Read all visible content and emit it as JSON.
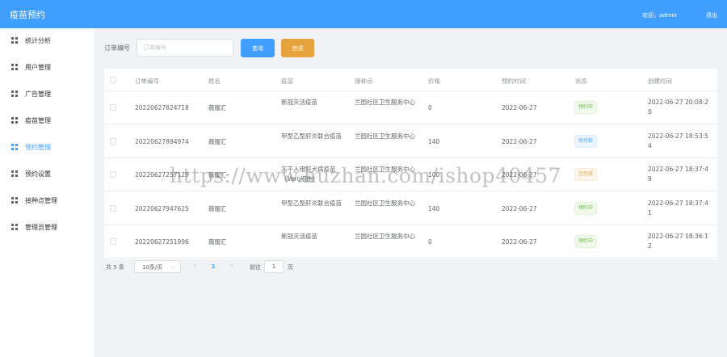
{
  "header": {
    "title": "疫苗预约",
    "welcome": "欢迎，admin",
    "logout": "退出"
  },
  "sidebar": {
    "items": [
      {
        "label": "统计分析"
      },
      {
        "label": "用户管理"
      },
      {
        "label": "广告管理"
      },
      {
        "label": "疫苗管理"
      },
      {
        "label": "预约管理"
      },
      {
        "label": "预约设置"
      },
      {
        "label": "接种点管理"
      },
      {
        "label": "管理员管理"
      }
    ],
    "active_index": 4
  },
  "search": {
    "label": "订单编号",
    "placeholder": "订单编号",
    "query_button": "查询",
    "done_button": "完成"
  },
  "table": {
    "columns": [
      "订单编号",
      "姓名",
      "疫苗",
      "接种点",
      "价格",
      "预约时间",
      "状态",
      "创建时间"
    ],
    "rows": [
      {
        "order_no": "20220627824718",
        "name": "薇服汇",
        "vaccine": "新冠灭活疫苗",
        "site": "兰园社区卫生服务中心",
        "price": "0",
        "date": "2022-06-27",
        "status": "预约中",
        "status_type": "success",
        "created": "2022-06-27 20:08:20"
      },
      {
        "order_no": "20220627894974",
        "name": "薇服汇",
        "vaccine": "甲型乙型肝炎联合疫苗",
        "site": "兰园社区卫生服务中心",
        "price": "140",
        "date": "2022-06-27",
        "status": "待付款",
        "status_type": "info",
        "created": "2022-06-27 18:53:54"
      },
      {
        "order_no": "20220627257129",
        "name": "薇服汇",
        "vaccine": "冻干人用狂犬病疫苗（Vero细胞）",
        "site": "兰园社区卫生服务中心",
        "price": "100",
        "date": "2022-06-27",
        "status": "已完成",
        "status_type": "warning",
        "created": "2022-06-27 18:37:49"
      },
      {
        "order_no": "20220627947625",
        "name": "薇服汇",
        "vaccine": "甲型乙型肝炎联合疫苗",
        "site": "兰园社区卫生服务中心",
        "price": "140",
        "date": "2022-06-27",
        "status": "预约中",
        "status_type": "success",
        "created": "2022-06-27 18:37:41"
      },
      {
        "order_no": "20220627251996",
        "name": "薇服汇",
        "vaccine": "新冠灭活疫苗",
        "site": "兰园社区卫生服务中心",
        "price": "0",
        "date": "2022-06-27",
        "status": "预约中",
        "status_type": "success",
        "created": "2022-06-27 18:36:12"
      }
    ]
  },
  "pagination": {
    "total": "共 5 条",
    "page_size": "10条/页",
    "prev": "‹",
    "current": "1",
    "next": "›",
    "goto_label": "前往",
    "goto_value": "1",
    "page_suffix": "页"
  },
  "watermark": "https://www.huzhan.com/ishop40457",
  "colors": {
    "primary": "#409eff",
    "warning": "#e6a23c",
    "success": "#67c23a",
    "info": "#409eff"
  }
}
